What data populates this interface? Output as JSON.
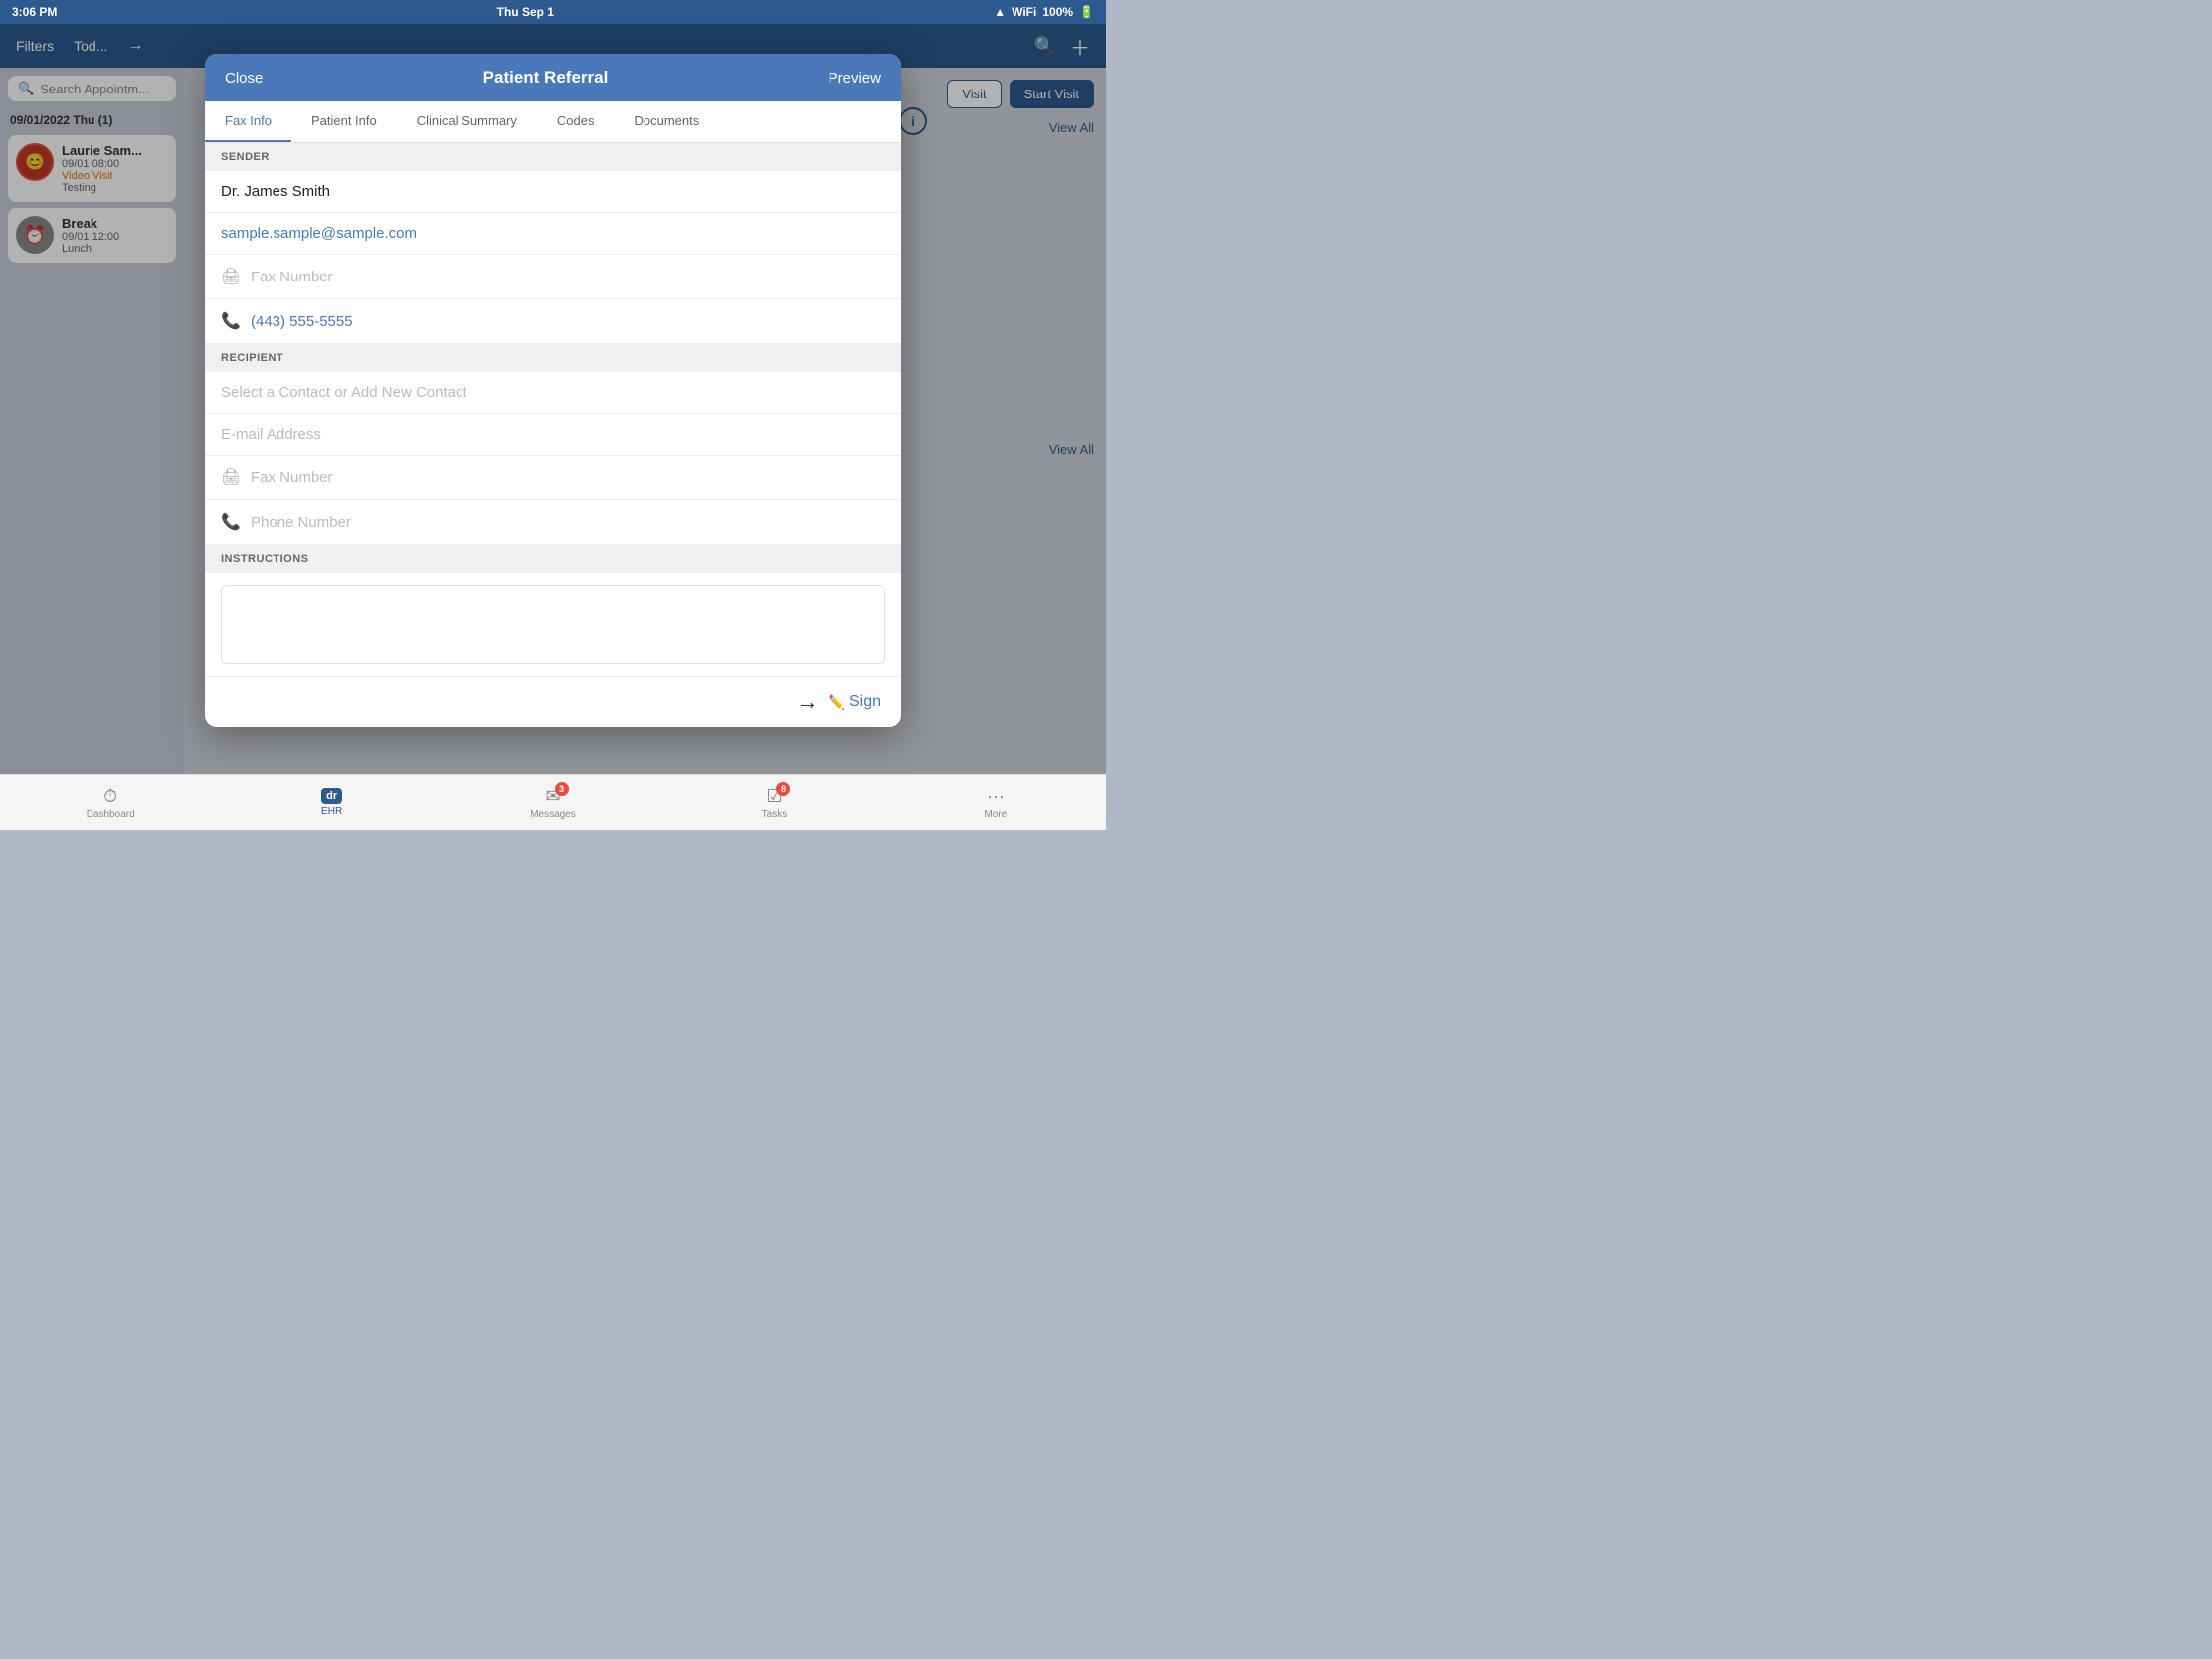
{
  "statusBar": {
    "time": "3:06 PM",
    "date": "Thu Sep 1",
    "battery": "100%"
  },
  "topBar": {
    "filters": "Filters",
    "today": "Tod...",
    "forward_icon": "→"
  },
  "sidebar": {
    "searchPlaceholder": "Search Appointm...",
    "dateHeader": "09/01/2022 Thu (1)",
    "appointments": [
      {
        "name": "Laurie Sam...",
        "time": "09/01 08:00",
        "type": "Video Visit",
        "note": "Testing"
      },
      {
        "name": "Break",
        "time": "09/01 12:00",
        "note": "Lunch"
      }
    ]
  },
  "mainArea": {
    "startVisitBtn": "Start Visit",
    "viewAllLabel": "View All",
    "viewAllLabel2": "View All",
    "infoIcon": "i"
  },
  "modal": {
    "closeLabel": "Close",
    "title": "Patient Referral",
    "previewLabel": "Preview",
    "tabs": [
      {
        "id": "fax-info",
        "label": "Fax Info",
        "active": true
      },
      {
        "id": "patient-info",
        "label": "Patient Info",
        "active": false
      },
      {
        "id": "clinical-summary",
        "label": "Clinical Summary",
        "active": false
      },
      {
        "id": "codes",
        "label": "Codes",
        "active": false
      },
      {
        "id": "documents",
        "label": "Documents",
        "active": false
      }
    ],
    "senderSection": {
      "header": "SENDER",
      "doctorName": "Dr. James Smith",
      "email": "sample.sample@sample.com",
      "faxNumberPlaceholder": "Fax Number",
      "phone": "(443) 555-5555"
    },
    "recipientSection": {
      "header": "RECIPIENT",
      "contactPlaceholder": "Select a Contact or Add New Contact",
      "emailPlaceholder": "E-mail Address",
      "faxPlaceholder": "Fax Number",
      "phonePlaceholder": "Phone Number"
    },
    "instructionsSection": {
      "header": "INSTRUCTIONS"
    },
    "footer": {
      "signLabel": "Sign"
    }
  },
  "bottomTabs": [
    {
      "id": "dashboard",
      "label": "Dashboard",
      "icon": "⏱",
      "active": false,
      "badge": null
    },
    {
      "id": "ehr",
      "label": "EHR",
      "icon": "dr",
      "active": true,
      "badge": null
    },
    {
      "id": "messages",
      "label": "Messages",
      "icon": "✉",
      "active": false,
      "badge": "3"
    },
    {
      "id": "tasks",
      "label": "Tasks",
      "icon": "☑",
      "active": false,
      "badge": "8"
    },
    {
      "id": "more",
      "label": "More",
      "icon": "•••",
      "active": false,
      "badge": null
    }
  ]
}
